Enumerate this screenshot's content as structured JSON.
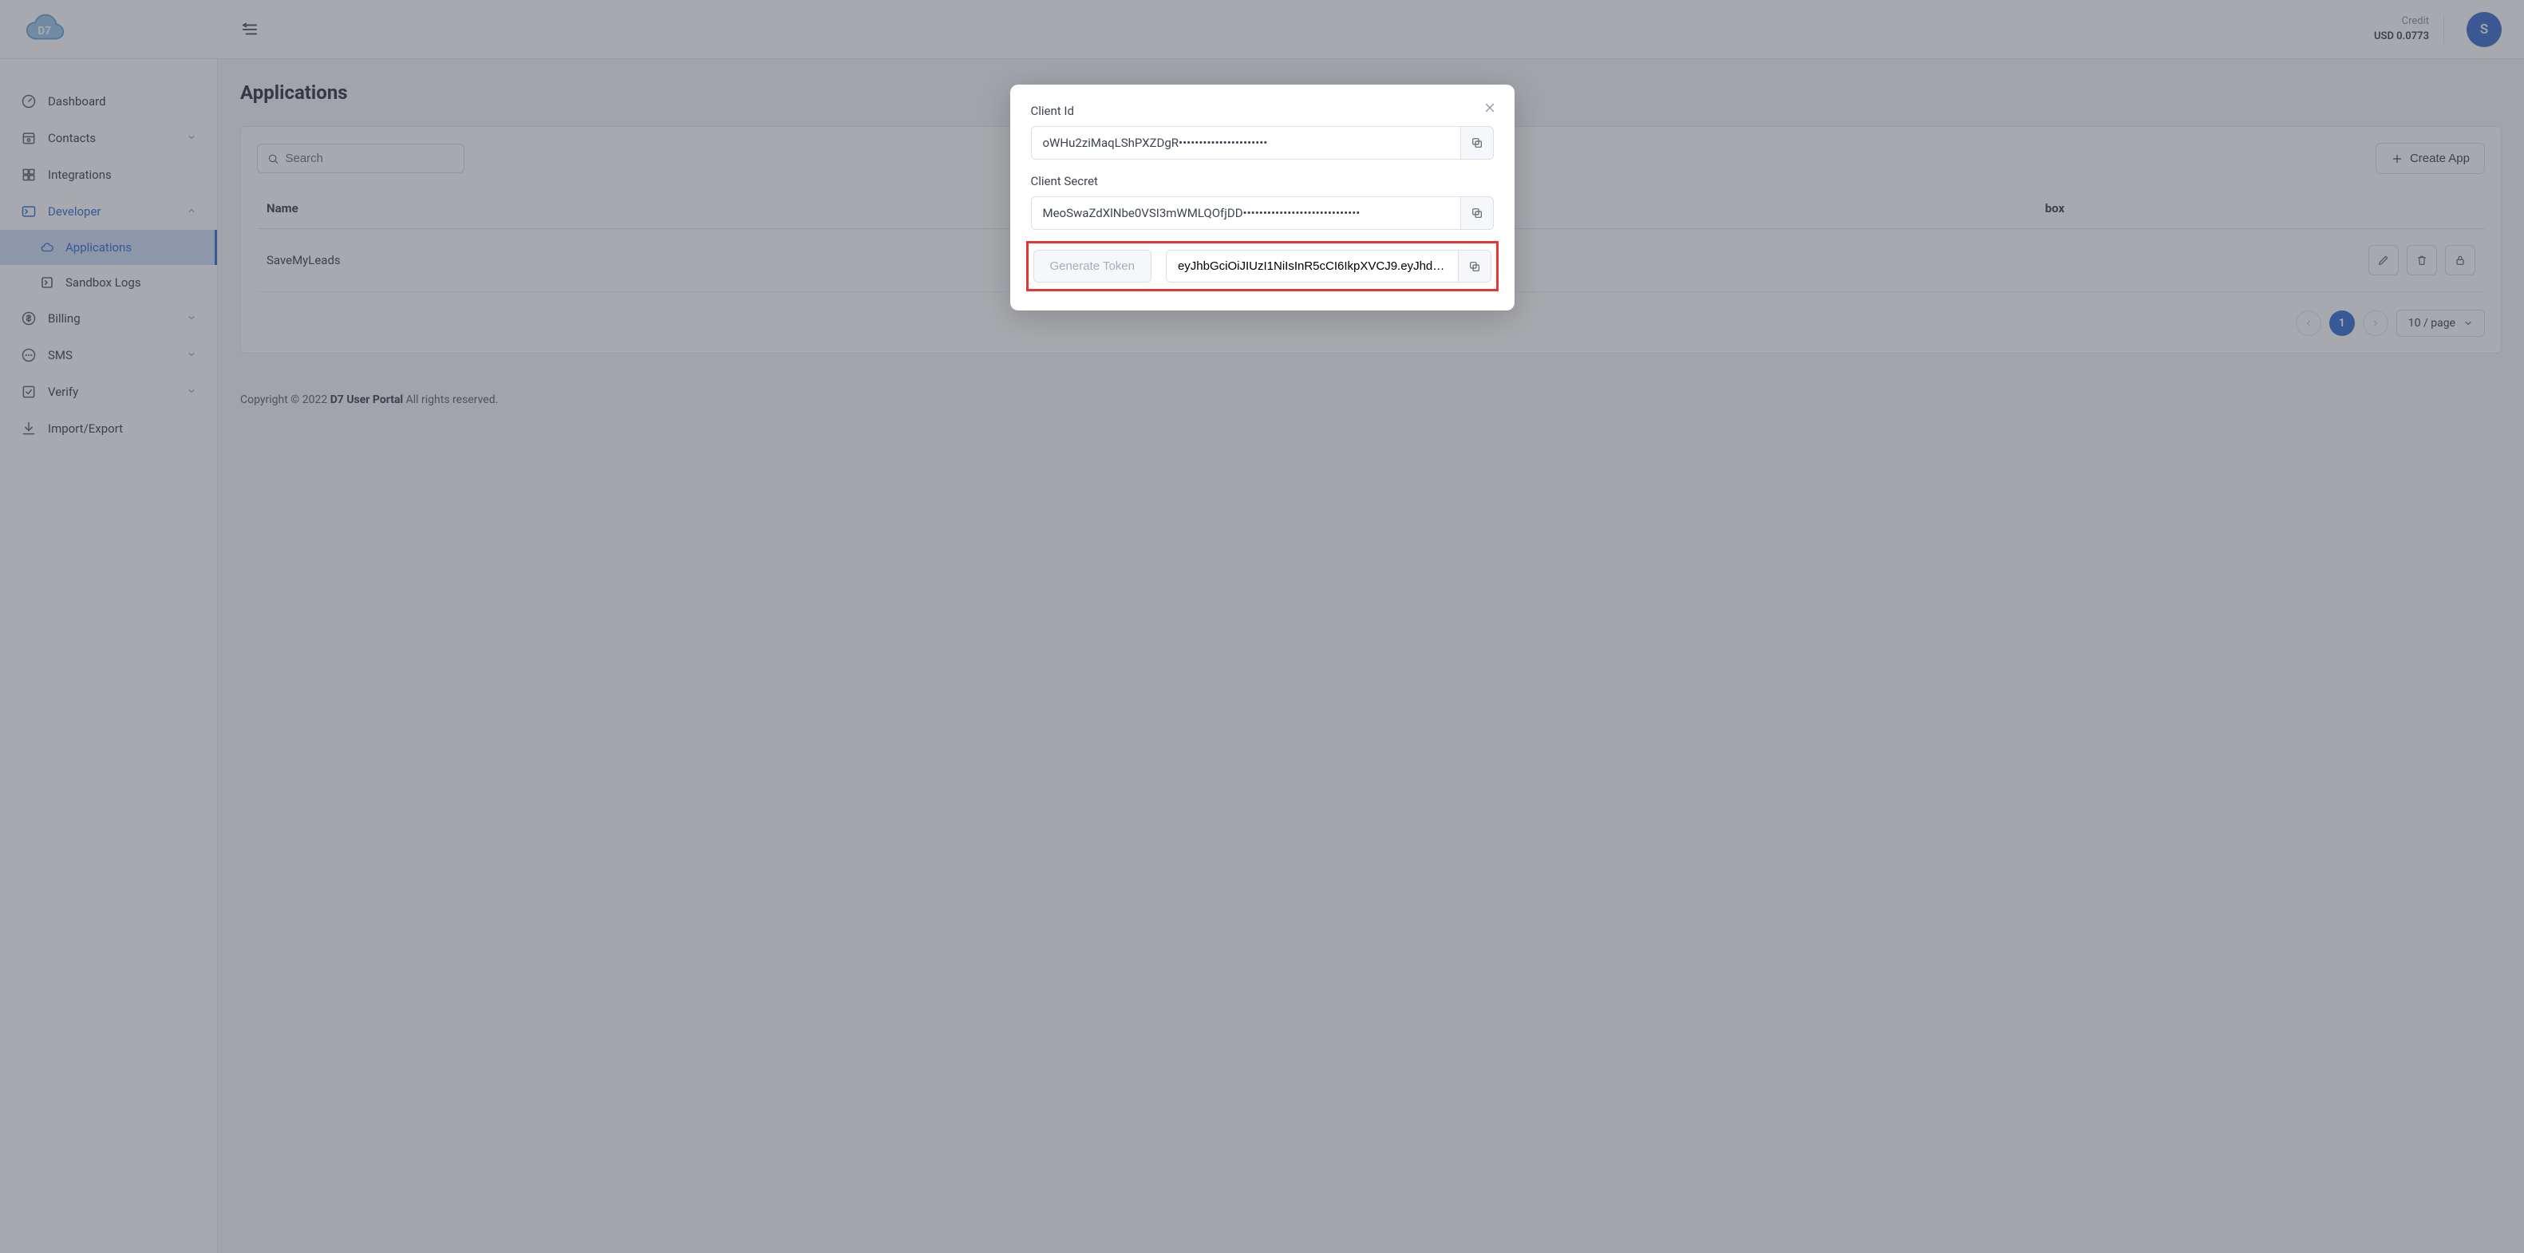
{
  "header": {
    "credit_label": "Credit",
    "credit_value": "USD 0.0773",
    "avatar_initial": "S"
  },
  "sidebar": {
    "items": [
      {
        "label": "Dashboard",
        "icon": "gauge-icon",
        "expandable": false
      },
      {
        "label": "Contacts",
        "icon": "calendar-contacts-icon",
        "expandable": true
      },
      {
        "label": "Integrations",
        "icon": "grid-icon",
        "expandable": false
      },
      {
        "label": "Developer",
        "icon": "terminal-icon",
        "expandable": true,
        "expanded": true,
        "active_parent": true,
        "children": [
          {
            "label": "Applications",
            "icon": "cloud-icon",
            "active": true
          },
          {
            "label": "Sandbox Logs",
            "icon": "terminal-square-icon",
            "active": false
          }
        ]
      },
      {
        "label": "Billing",
        "icon": "dollar-icon",
        "expandable": true
      },
      {
        "label": "SMS",
        "icon": "chat-icon",
        "expandable": true
      },
      {
        "label": "Verify",
        "icon": "check-square-icon",
        "expandable": true
      },
      {
        "label": "Import/Export",
        "icon": "download-icon",
        "expandable": false
      }
    ]
  },
  "page": {
    "title": "Applications",
    "search_placeholder": "Search",
    "create_btn": "Create App",
    "columns": {
      "name": "Name",
      "sandbox": "box"
    },
    "rows": [
      {
        "name": "SaveMyLeads"
      }
    ],
    "pagination": {
      "current": "1",
      "page_size_label": "10 / page"
    }
  },
  "footer": {
    "prefix": "Copyright © 2022 ",
    "brand": "D7 User Portal",
    "suffix": " All rights reserved."
  },
  "modal": {
    "client_id_label": "Client Id",
    "client_id_value": "oWHu2ziMaqLShPXZDgR••••••••••••••••••••••",
    "client_secret_label": "Client Secret",
    "client_secret_value": "MeoSwaZdXlNbe0VSI3mWMLQOfjDD•••••••••••••••••••••••••••••",
    "generate_token_btn": "Generate Token",
    "token_value": "eyJhbGciOiJIUzI1NiIsInR5cCI6IkpXVCJ9.eyJhdWQ"
  }
}
